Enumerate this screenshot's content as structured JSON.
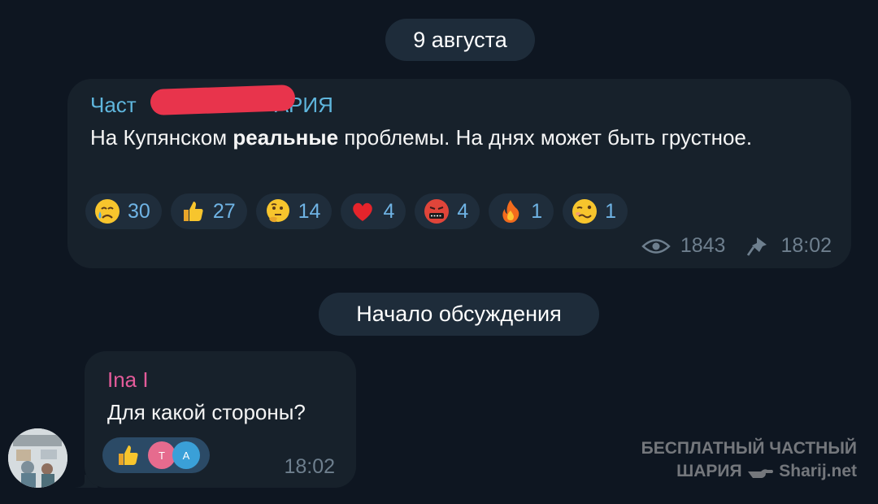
{
  "date_label": "9 августа",
  "channel_post": {
    "sender_visible_left": "Част",
    "sender_visible_right": "АРИЯ",
    "text_before": "На Купянском ",
    "text_bold": "реальные",
    "text_after": " проблемы. На днях может быть грустное.",
    "reactions": [
      {
        "emoji": "crying-face-icon",
        "count": "30"
      },
      {
        "emoji": "thumbs-up-icon",
        "count": "27"
      },
      {
        "emoji": "thinking-face-icon",
        "count": "14"
      },
      {
        "emoji": "red-heart-icon",
        "count": "4"
      },
      {
        "emoji": "cursing-face-icon",
        "count": "4"
      },
      {
        "emoji": "fire-icon",
        "count": "1"
      },
      {
        "emoji": "woozy-face-icon",
        "count": "1"
      }
    ],
    "views": "1843",
    "time": "18:02"
  },
  "thread_label": "Начало обсуждения",
  "comment": {
    "sender": "Ina I",
    "text": "Для какой стороны?",
    "reaction_emoji": "thumbs-up-icon",
    "reactor_initials": [
      "T",
      "A"
    ],
    "time": "18:02"
  },
  "watermark": {
    "line1": "БЕСПЛАТНЫЙ ЧАСТНЫЙ",
    "line2_left": "ШАРИЯ",
    "line2_right": "Sharij.net"
  },
  "colors": {
    "background": "#0e1621",
    "bubble": "#17212b",
    "channel_name": "#5fb6dd",
    "commenter_name": "#e35b9a",
    "reaction_count": "#6fb3e4",
    "redaction": "#e8344c"
  }
}
